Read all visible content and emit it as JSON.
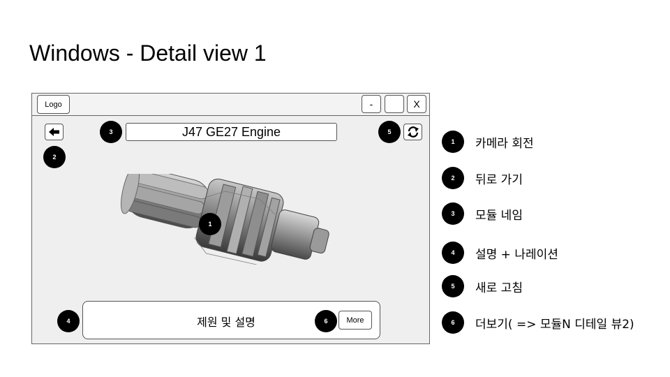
{
  "slide": {
    "title": "Windows - Detail view 1"
  },
  "window": {
    "logo_label": "Logo",
    "minimize_label": "-",
    "maximize_label": "",
    "close_label": "X",
    "module_name": "J47 GE27 Engine",
    "description_label": "제원 및 설명",
    "more_label": "More"
  },
  "badges": {
    "b1": "1",
    "b2": "2",
    "b3": "3",
    "b4": "4",
    "b5": "5",
    "b6": "6"
  },
  "legend": [
    {
      "num": "1",
      "text": "카메라 회전"
    },
    {
      "num": "2",
      "text": "뒤로 가기"
    },
    {
      "num": "3",
      "text": "모듈 네임"
    },
    {
      "num": "4",
      "text": "설명 + 나레이션"
    },
    {
      "num": "5",
      "text": "새로 고침"
    },
    {
      "num": "6",
      "text": "더보기( => 모듈N 디테일 뷰2)"
    }
  ],
  "icons": {
    "back": "arrow-left-icon",
    "refresh": "refresh-icon",
    "model": "jet-engine-model"
  }
}
